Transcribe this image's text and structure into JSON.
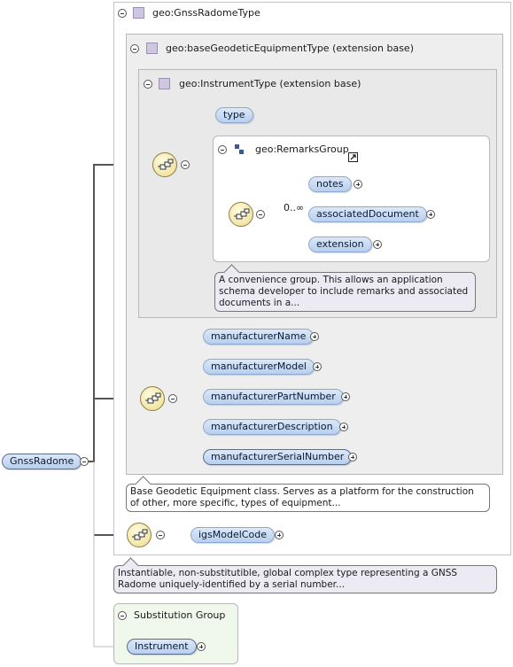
{
  "root": {
    "name": "GnssRadome"
  },
  "gnss_radome_type": {
    "title": "geo:GnssRadomeType"
  },
  "base_type": {
    "title": "geo:baseGeodeticEquipmentType (extension base)"
  },
  "instrument_type": {
    "title": "geo:InstrumentType (extension base)"
  },
  "remarks_group": {
    "title": "geo:RemarksGroup"
  },
  "elements": {
    "type": "type",
    "notes": "notes",
    "associated_document": "associatedDocument",
    "extension": "extension",
    "occurrence": "0..∞",
    "manufacturer_name": "manufacturerName",
    "manufacturer_model": "manufacturerModel",
    "manufacturer_part_number": "manufacturerPartNumber",
    "manufacturer_description": "manufacturerDescription",
    "manufacturer_serial_number": "manufacturerSerialNumber",
    "igs_model_code": "igsModelCode",
    "instrument": "Instrument"
  },
  "annotations": {
    "remarks": "A convenience group. This allows an application schema developer to include remarks and associated documents in a...",
    "base": "Base Geodetic Equipment class. Serves as a platform for the construction of other, more specific, types of equipment...",
    "radome": "Instantiable, non-substitutible, global complex type representing a GNSS Radome uniquely-identified by a serial number..."
  },
  "substitution": {
    "title": "Substitution Group"
  },
  "colors": {
    "pill_fill": "#c7daf3",
    "pill_border": "#8ea9cf",
    "sequence_fill": "#f1e6a6",
    "box_gray": "#eeeeee",
    "box_green": "#f0f8ec",
    "type_square": "#cfc6e0"
  },
  "icons": [
    "sequence-icon",
    "collapse-icon",
    "expand-icon",
    "type-icon",
    "group-icon",
    "link-icon"
  ]
}
